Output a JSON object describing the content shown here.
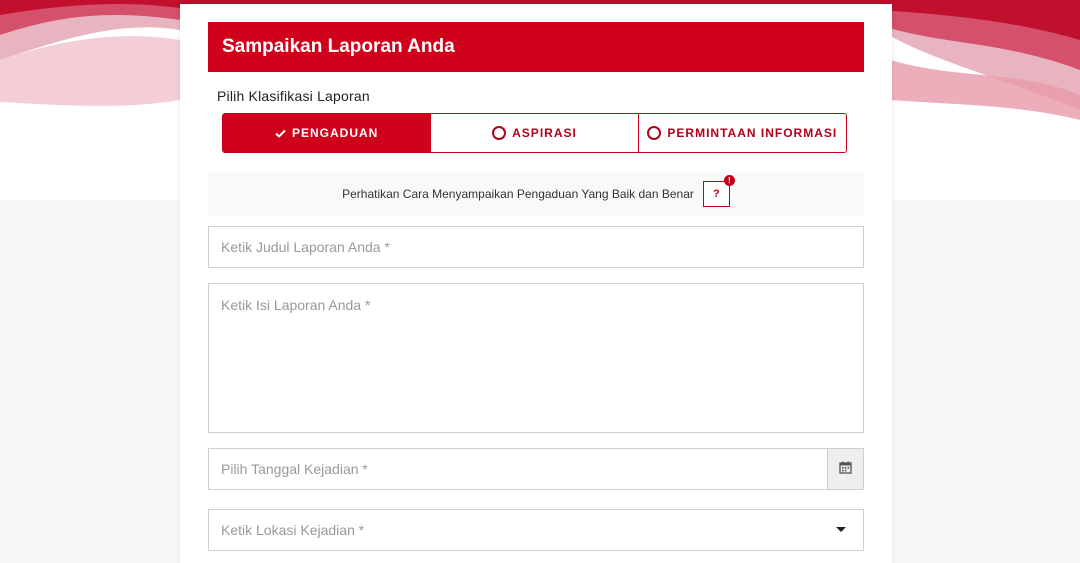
{
  "form": {
    "title": "Sampaikan Laporan Anda",
    "classification_label": "Pilih Klasifikasi Laporan",
    "classifications": [
      {
        "label": "PENGADUAN",
        "selected": true
      },
      {
        "label": "ASPIRASI",
        "selected": false
      },
      {
        "label": "PERMINTAAN INFORMASI",
        "selected": false
      }
    ],
    "notice_text": "Perhatikan Cara Menyampaikan Pengaduan Yang Baik dan Benar",
    "help_label": "?",
    "help_badge": "!",
    "title_placeholder": "Ketik Judul Laporan Anda *",
    "body_placeholder": "Ketik Isi Laporan Anda *",
    "date_placeholder": "Pilih Tanggal Kejadian *",
    "location_placeholder": "Ketik Lokasi Kejadian *"
  },
  "colors": {
    "brand": "#d0021b",
    "border": "#cfcfcf",
    "placeholder": "#999999"
  },
  "icons": {
    "selected": "check-icon",
    "unselected": "radio-ring-icon",
    "date": "calendar-icon",
    "dropdown": "caret-down-icon"
  }
}
